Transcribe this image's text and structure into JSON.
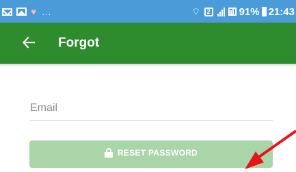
{
  "status_bar": {
    "left_icons": [
      "mail-icon",
      "image-icon",
      "heart-icon"
    ],
    "more_indicator": "...",
    "sim_label": "2",
    "battery_percent": "91%",
    "time": "21:43"
  },
  "app_bar": {
    "back_icon": "arrow-left-icon",
    "title": "Forgot"
  },
  "form": {
    "email_placeholder": "Email",
    "email_value": ""
  },
  "reset_button": {
    "icon": "lock-icon",
    "label": "RESET PASSWORD"
  },
  "annotation": {
    "arrow_color": "#e8141a"
  },
  "colors": {
    "status_bar": "#4a9bd8",
    "app_bar": "#2e8b2e",
    "reset_button": "#a9d5a9"
  }
}
